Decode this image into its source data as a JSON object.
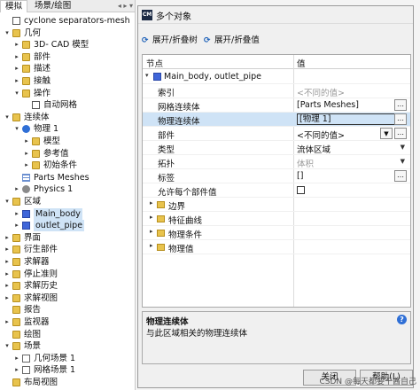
{
  "left": {
    "tabs": [
      "模拟",
      "场景/绘图"
    ],
    "tree": [
      {
        "label": "cyclone separators-mesh",
        "indent": 0,
        "toggle": "",
        "icon": "mesh"
      },
      {
        "label": "几何",
        "indent": 0,
        "toggle": "▾",
        "icon": "folder"
      },
      {
        "label": "3D- CAD 模型",
        "indent": 1,
        "toggle": "▸",
        "icon": "folder"
      },
      {
        "label": "部件",
        "indent": 1,
        "toggle": "▸",
        "icon": "folder"
      },
      {
        "label": "描述",
        "indent": 1,
        "toggle": "▸",
        "icon": "folder"
      },
      {
        "label": "接触",
        "indent": 1,
        "toggle": "▸",
        "icon": "folder"
      },
      {
        "label": "操作",
        "indent": 1,
        "toggle": "▾",
        "icon": "folder"
      },
      {
        "label": "自动网格",
        "indent": 2,
        "toggle": "",
        "icon": "mesh"
      },
      {
        "label": "连续体",
        "indent": 0,
        "toggle": "▾",
        "icon": "folder"
      },
      {
        "label": "物理 1",
        "indent": 1,
        "toggle": "▾",
        "icon": "dot"
      },
      {
        "label": "模型",
        "indent": 2,
        "toggle": "▸",
        "icon": "folder"
      },
      {
        "label": "参考值",
        "indent": 2,
        "toggle": "▸",
        "icon": "folder"
      },
      {
        "label": "初始条件",
        "indent": 2,
        "toggle": "▸",
        "icon": "folder"
      },
      {
        "label": "Parts Meshes",
        "indent": 1,
        "toggle": "",
        "icon": "grid"
      },
      {
        "label": "Physics 1",
        "indent": 1,
        "toggle": "▸",
        "icon": "dotgray"
      },
      {
        "label": "区域",
        "indent": 0,
        "toggle": "▾",
        "icon": "folder"
      },
      {
        "label": "Main_body",
        "indent": 1,
        "toggle": "▸",
        "icon": "blue",
        "selected": true
      },
      {
        "label": "outlet_pipe",
        "indent": 1,
        "toggle": "▸",
        "icon": "blue",
        "selected": true
      },
      {
        "label": "界面",
        "indent": 0,
        "toggle": "▸",
        "icon": "folder"
      },
      {
        "label": "衍生部件",
        "indent": 0,
        "toggle": "▸",
        "icon": "folder"
      },
      {
        "label": "求解器",
        "indent": 0,
        "toggle": "▸",
        "icon": "folder"
      },
      {
        "label": "停止准则",
        "indent": 0,
        "toggle": "▸",
        "icon": "folder"
      },
      {
        "label": "求解历史",
        "indent": 0,
        "toggle": "▸",
        "icon": "folder"
      },
      {
        "label": "求解视图",
        "indent": 0,
        "toggle": "▸",
        "icon": "folder"
      },
      {
        "label": "报告",
        "indent": 0,
        "toggle": "",
        "icon": "folder"
      },
      {
        "label": "监视器",
        "indent": 0,
        "toggle": "▸",
        "icon": "folder"
      },
      {
        "label": "绘图",
        "indent": 0,
        "toggle": "",
        "icon": "folder"
      },
      {
        "label": "场景",
        "indent": 0,
        "toggle": "▾",
        "icon": "folder"
      },
      {
        "label": "几何场景 1",
        "indent": 1,
        "toggle": "▸",
        "icon": "cal"
      },
      {
        "label": "网格场景 1",
        "indent": 1,
        "toggle": "▸",
        "icon": "cal"
      },
      {
        "label": "布局视图",
        "indent": 0,
        "toggle": "",
        "icon": "folder"
      }
    ]
  },
  "dialog": {
    "icon_text": "CM",
    "title": "多个对象",
    "toolbar": {
      "expand_tree": "展开/折叠树",
      "expand_values": "展开/折叠值"
    },
    "columns": {
      "node": "节点",
      "value": "值"
    },
    "root": {
      "label": "Main_body, outlet_pipe"
    },
    "rows": [
      {
        "key": "索引",
        "value": "<不同的值>",
        "kind": "muted"
      },
      {
        "key": "网格连续体",
        "value": "[Parts Meshes]",
        "kind": "ellipsis"
      },
      {
        "key": "物理连续体",
        "value": "[物理 1]",
        "kind": "boxed",
        "highlight": true
      },
      {
        "key": "部件",
        "value": "<不同的值>",
        "kind": "filter"
      },
      {
        "key": "类型",
        "value": "流体区域",
        "kind": "dropdown"
      },
      {
        "key": "拓扑",
        "value": "体积",
        "kind": "dropdown-muted"
      },
      {
        "key": "标签",
        "value": "[]",
        "kind": "ellipsis"
      },
      {
        "key": "允许每个部件值",
        "value": "",
        "kind": "checkbox"
      }
    ],
    "groups": [
      "边界",
      "特征曲线",
      "物理条件",
      "物理值"
    ],
    "description": {
      "title": "物理连续体",
      "text": "与此区域相关的物理连续体"
    },
    "buttons": {
      "close": "关闭",
      "help": "帮助(L)"
    }
  },
  "watermark": "CSDN @每天都要干酱自己"
}
